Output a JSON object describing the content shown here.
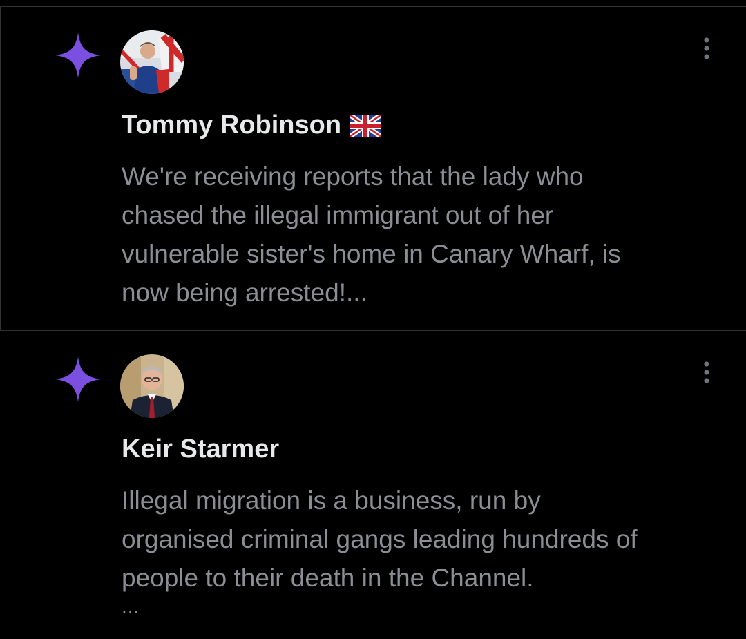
{
  "colors": {
    "background": "#000000",
    "divider": "#2f3336",
    "author_text": "#e7e9ea",
    "body_text": "#8b8f94",
    "sparkle": "#7b4fe0",
    "icon_gray": "#6e767d"
  },
  "posts": [
    {
      "icon": "sparkle-icon",
      "avatar": "avatar-photo",
      "author": "Tommy Robinson",
      "author_badge": "uk-flag-icon",
      "text": "We're receiving reports that the lady who\nchased the illegal immigrant out of her\nvulnerable sister's home in Canary Wharf, is\nnow being arrested!...",
      "trailing": ""
    },
    {
      "icon": "sparkle-icon",
      "avatar": "avatar-photo",
      "author": "Keir Starmer",
      "author_badge": "",
      "text": "Illegal migration is a business, run by\norganised criminal gangs leading hundreds of\npeople to their death in the Channel.",
      "trailing": "..."
    }
  ]
}
